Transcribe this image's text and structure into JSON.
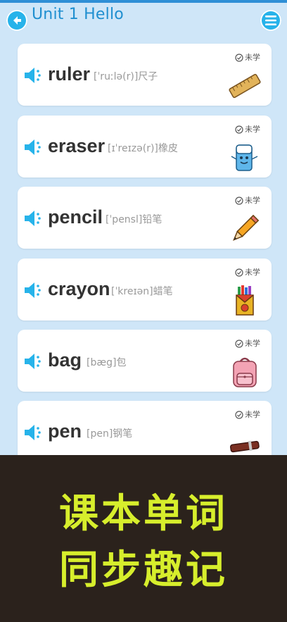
{
  "header": {
    "title": "Unit 1 Hello"
  },
  "words": [
    {
      "word": "ruler",
      "phonetic": "[ˈruːlə(r)]尺子",
      "status": "未学",
      "icon": "ruler-icon"
    },
    {
      "word": "eraser",
      "phonetic": "[ɪˈreɪzə(r)]橡皮",
      "status": "未学",
      "icon": "eraser-icon"
    },
    {
      "word": "pencil",
      "phonetic": "[ˈpensl]铅笔",
      "status": "未学",
      "icon": "pencil-icon"
    },
    {
      "word": "crayon",
      "phonetic": "[ˈkreɪən]蜡笔",
      "status": "未学",
      "icon": "crayon-box-icon"
    },
    {
      "word": "bag",
      "phonetic": "[bæg]包",
      "status": "未学",
      "icon": "backpack-icon"
    },
    {
      "word": "pen",
      "phonetic": "[pen]钢笔",
      "status": "未学",
      "icon": "pen-icon"
    }
  ],
  "banner": {
    "line1": "课本单词",
    "line2": "同步趣记"
  },
  "colors": {
    "accent": "#27b3ea",
    "background": "#cfe6f8",
    "banner": "#2b221c",
    "banner_text": "#d7ee2c"
  }
}
